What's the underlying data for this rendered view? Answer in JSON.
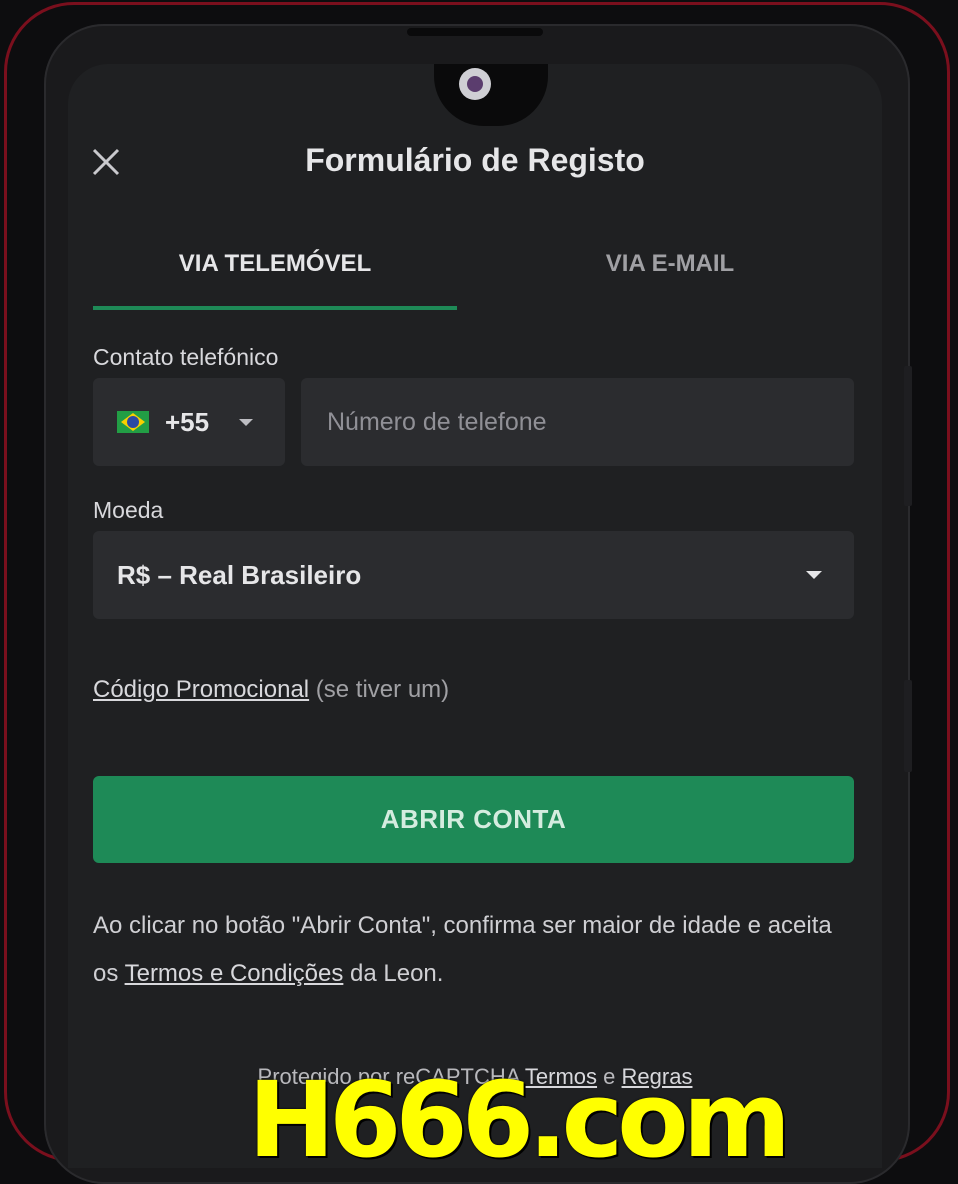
{
  "header": {
    "title": "Formulário de Registo",
    "close_icon": "close-icon"
  },
  "tabs": [
    {
      "label": "VIA TELEMÓVEL",
      "active": true
    },
    {
      "label": "VIA E-MAIL",
      "active": false
    }
  ],
  "phone": {
    "label": "Contato telefónico",
    "country_flag": "brazil-flag-icon",
    "country_code": "+55",
    "placeholder": "Número de telefone"
  },
  "currency": {
    "label": "Moeda",
    "value": "R$ – Real Brasileiro"
  },
  "promo": {
    "link": "Código Promocional",
    "hint": "(se tiver um)"
  },
  "submit_label": "ABRIR CONTA",
  "disclaimer": {
    "before": "Ao clicar no botão \"Abrir Conta\", confirma ser maior de idade e aceita os ",
    "link": "Termos e Condições",
    "after": " da Leon."
  },
  "recaptcha": {
    "prefix": "Protegido por reCAPTCHA",
    "terms": "Termos",
    "and": "e",
    "rules": "Regras"
  },
  "watermark": "H666.com",
  "colors": {
    "accent": "#1e8a57",
    "background": "#1f2022",
    "field": "#2b2c2f",
    "frame": "#7a0f1d",
    "watermark": "#ffff00"
  }
}
